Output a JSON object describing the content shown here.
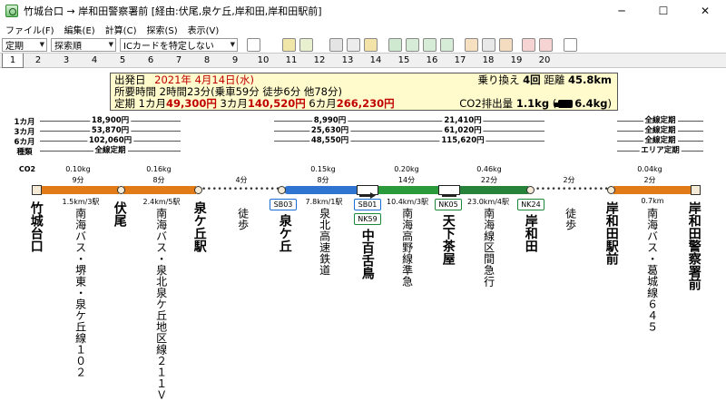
{
  "window": {
    "title": "竹城台口 → 岸和田警察署前 [経由:伏尾,泉ケ丘,岸和田,岸和田駅前]",
    "minimize": "─",
    "maximize": "☐",
    "close": "✕"
  },
  "menu": [
    "ファイル(F)",
    "編集(E)",
    "計算(C)",
    "探索(S)",
    "表示(V)"
  ],
  "toolbar": {
    "pass_select": "定期",
    "order_select": "探索順",
    "ic_select": "ICカードを特定しない",
    "icons": [
      "copy-icon",
      "table-icon",
      "edit-icon",
      "ex-icon",
      "layers-icon",
      "route-map-icon",
      "search-icon",
      "filter-icon",
      "settings-icon",
      "pdf-icon",
      "print-icon",
      "list-icon",
      "flag-back-icon",
      "flag-forward-icon",
      "memo-icon"
    ]
  },
  "tabs": [
    "1",
    "2",
    "3",
    "4",
    "5",
    "6",
    "7",
    "8",
    "9",
    "10",
    "11",
    "12",
    "13",
    "14",
    "15",
    "16",
    "17",
    "18",
    "19",
    "20"
  ],
  "summary": {
    "dep_label": "出発日",
    "dep_value": "2021年 4月14日(水)",
    "transfer_label": "乗り換え",
    "transfer_value": "4回",
    "distance_label": "距離",
    "distance_value": "45.8km",
    "time_label": "所要時間",
    "time_value": "2時間23分",
    "time_detail": "(乗車59分 徒歩6分 他78分)",
    "pass_label": "定期",
    "m1_label": "1カ月",
    "m1_value": "49,300円",
    "m3_label": "3カ月",
    "m3_value": "140,520円",
    "m6_label": "6カ月",
    "m6_value": "266,230円",
    "co2_label": "CO2排出量",
    "co2_value": "1.1kg",
    "co2_car": "6.4kg"
  },
  "fare_rows": [
    {
      "label": "1カ月",
      "values": [
        "18,900円",
        "8,990円",
        "21,410円",
        "全線定期"
      ]
    },
    {
      "label": "3カ月",
      "values": [
        "53,870円",
        "25,630円",
        "61,020円",
        "全線定期"
      ]
    },
    {
      "label": "6カ月",
      "values": [
        "102,060円",
        "48,550円",
        "115,620円",
        "全線定期"
      ]
    },
    {
      "label": "種類",
      "values": [
        "全線定期",
        "エリア定期"
      ]
    }
  ],
  "co2_label": "CO2",
  "co2_values": [
    "0.10kg",
    "0.16kg",
    "0.15kg",
    "0.20kg",
    "0.46kg",
    "0.04kg"
  ],
  "times": [
    "9分",
    "8分",
    "4分",
    "8分",
    "14分",
    "22分",
    "2分",
    "2分"
  ],
  "segments_info": [
    "1.5km/3駅",
    "2.4km/5駅",
    "7.8km/1駅",
    "10.4km/3駅",
    "23.0km/4駅",
    "0.7km"
  ],
  "stations": [
    "竹城台口",
    "伏尾",
    "泉ケ丘駅",
    "泉ケ丘",
    "中百舌鳥",
    "天下茶屋",
    "岸和田",
    "岸和田駅前",
    "岸和田警察署前"
  ],
  "lines": [
    "南海バス・堺東・泉ケ丘線１０２",
    "南海バス・泉北泉ケ丘地区線２１１Ｖ",
    "徒歩",
    "泉北高速鉄道",
    "南海高野線準急",
    "南海線区間急行",
    "徒歩",
    "南海バス・葛城線６４５"
  ],
  "badges": [
    "SB03",
    "SB01",
    "NK59",
    "NK05",
    "NK24"
  ],
  "colors": {
    "bus": "#e07b17",
    "semboku": "#2f74d0",
    "koya": "#2a9a3a",
    "nankai": "#27823a"
  }
}
